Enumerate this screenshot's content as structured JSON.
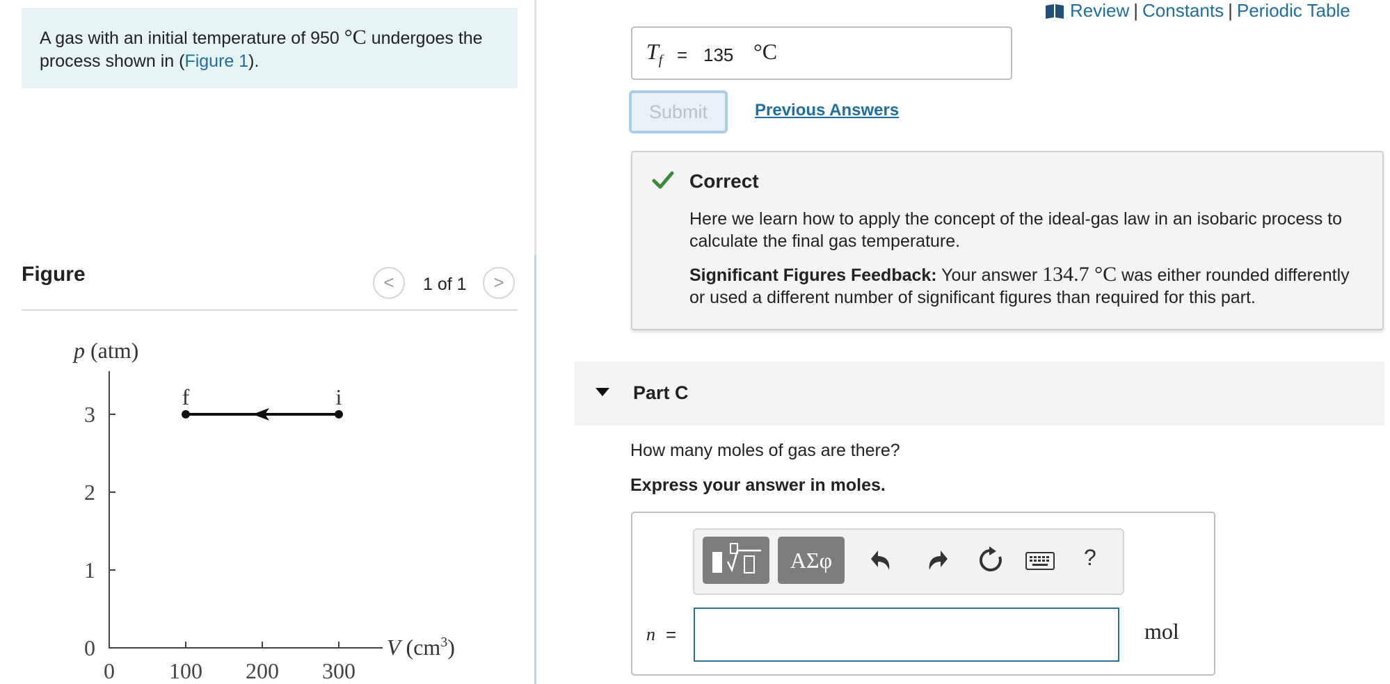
{
  "problem": {
    "text_before": "A gas with an initial temperature of 950 ",
    "deg_unit": "°C",
    "text_after": " undergoes the process shown in (",
    "figure_link": "Figure 1",
    "text_end": ")."
  },
  "figure": {
    "heading": "Figure",
    "pager": "1 of 1",
    "prev": "<",
    "next": ">"
  },
  "chart_data": {
    "type": "line",
    "ylabel": "p (atm)",
    "xlabel": "V (cm³)",
    "xlabel_base": "V (cm",
    "xlabel_sup": "3",
    "xlabel_end": ")",
    "xticks": [
      0,
      100,
      200,
      300
    ],
    "yticks": [
      0,
      1,
      2,
      3
    ],
    "xlim": [
      0,
      300
    ],
    "ylim": [
      0,
      3
    ],
    "series": [
      {
        "points": [
          {
            "x": 300,
            "y": 3,
            "label": "i"
          },
          {
            "x": 100,
            "y": 3,
            "label": "f"
          }
        ],
        "direction": "i-to-f"
      }
    ]
  },
  "header": {
    "links": [
      "Review",
      "Constants",
      "Periodic Table"
    ],
    "separator": "|"
  },
  "part_b": {
    "var": "T",
    "var_sub": "f",
    "eq": "=",
    "value": "135",
    "unit": "°C",
    "submit_label": "Submit",
    "previous_answers_label": "Previous Answers"
  },
  "feedback": {
    "title": "Correct",
    "body": "Here we learn how to apply the concept of the ideal-gas law in an isobaric process to calculate the final gas temperature.",
    "sig_label": "Significant Figures Feedback:",
    "sig_pre": " Your answer ",
    "sig_answer": "134.7 °C",
    "sig_post": " was either rounded differently or used a different number of significant figures than required for this part.",
    "accent_color": "#3a8a3a"
  },
  "part_c": {
    "title": "Part C",
    "question": "How many moles of gas are there?",
    "instruction": "Express your answer in moles.",
    "symbols_label": "ΑΣφ",
    "help_label": "?",
    "var": "n",
    "eq": "=",
    "input_value": "",
    "unit": "mol"
  },
  "colors": {
    "link": "#1f6ea0",
    "problem_bg": "#e6f4f6",
    "input_border": "#2a6f97"
  }
}
